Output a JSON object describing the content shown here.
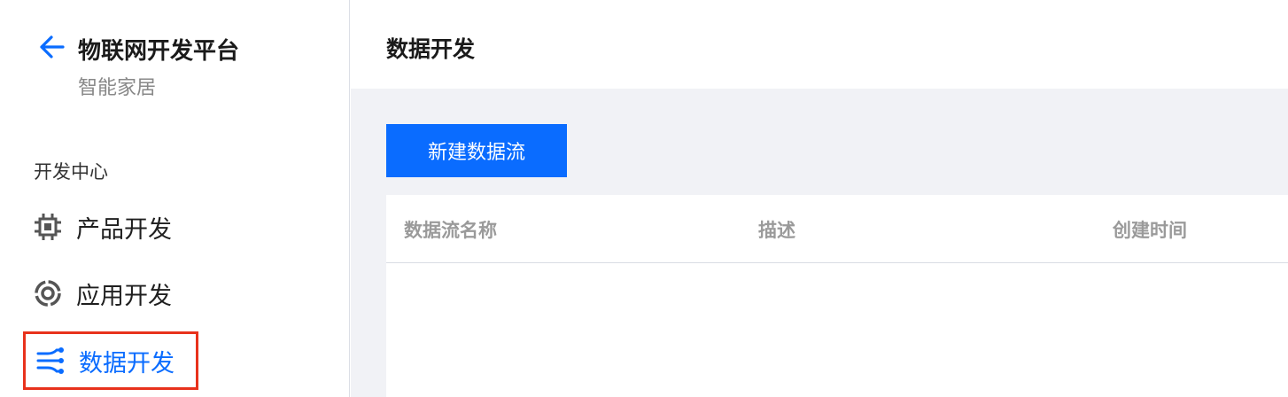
{
  "sidebar": {
    "app_title": "物联网开发平台",
    "project_name": "智能家居",
    "section_label": "开发中心",
    "items": [
      {
        "label": "产品开发",
        "icon": "chip-icon",
        "active": false
      },
      {
        "label": "应用开发",
        "icon": "app-ring-icon",
        "active": false
      },
      {
        "label": "数据开发",
        "icon": "data-flow-icon",
        "active": true
      }
    ]
  },
  "header": {
    "title": "数据开发"
  },
  "main": {
    "new_button_label": "新建数据流",
    "table": {
      "columns": [
        "数据流名称",
        "描述",
        "创建时间"
      ],
      "rows": []
    }
  },
  "colors": {
    "accent": "#0a6cff",
    "highlight_border": "#e8321c",
    "content_bg": "#f1f2f6",
    "header_text_gray": "#9a9a9a"
  }
}
